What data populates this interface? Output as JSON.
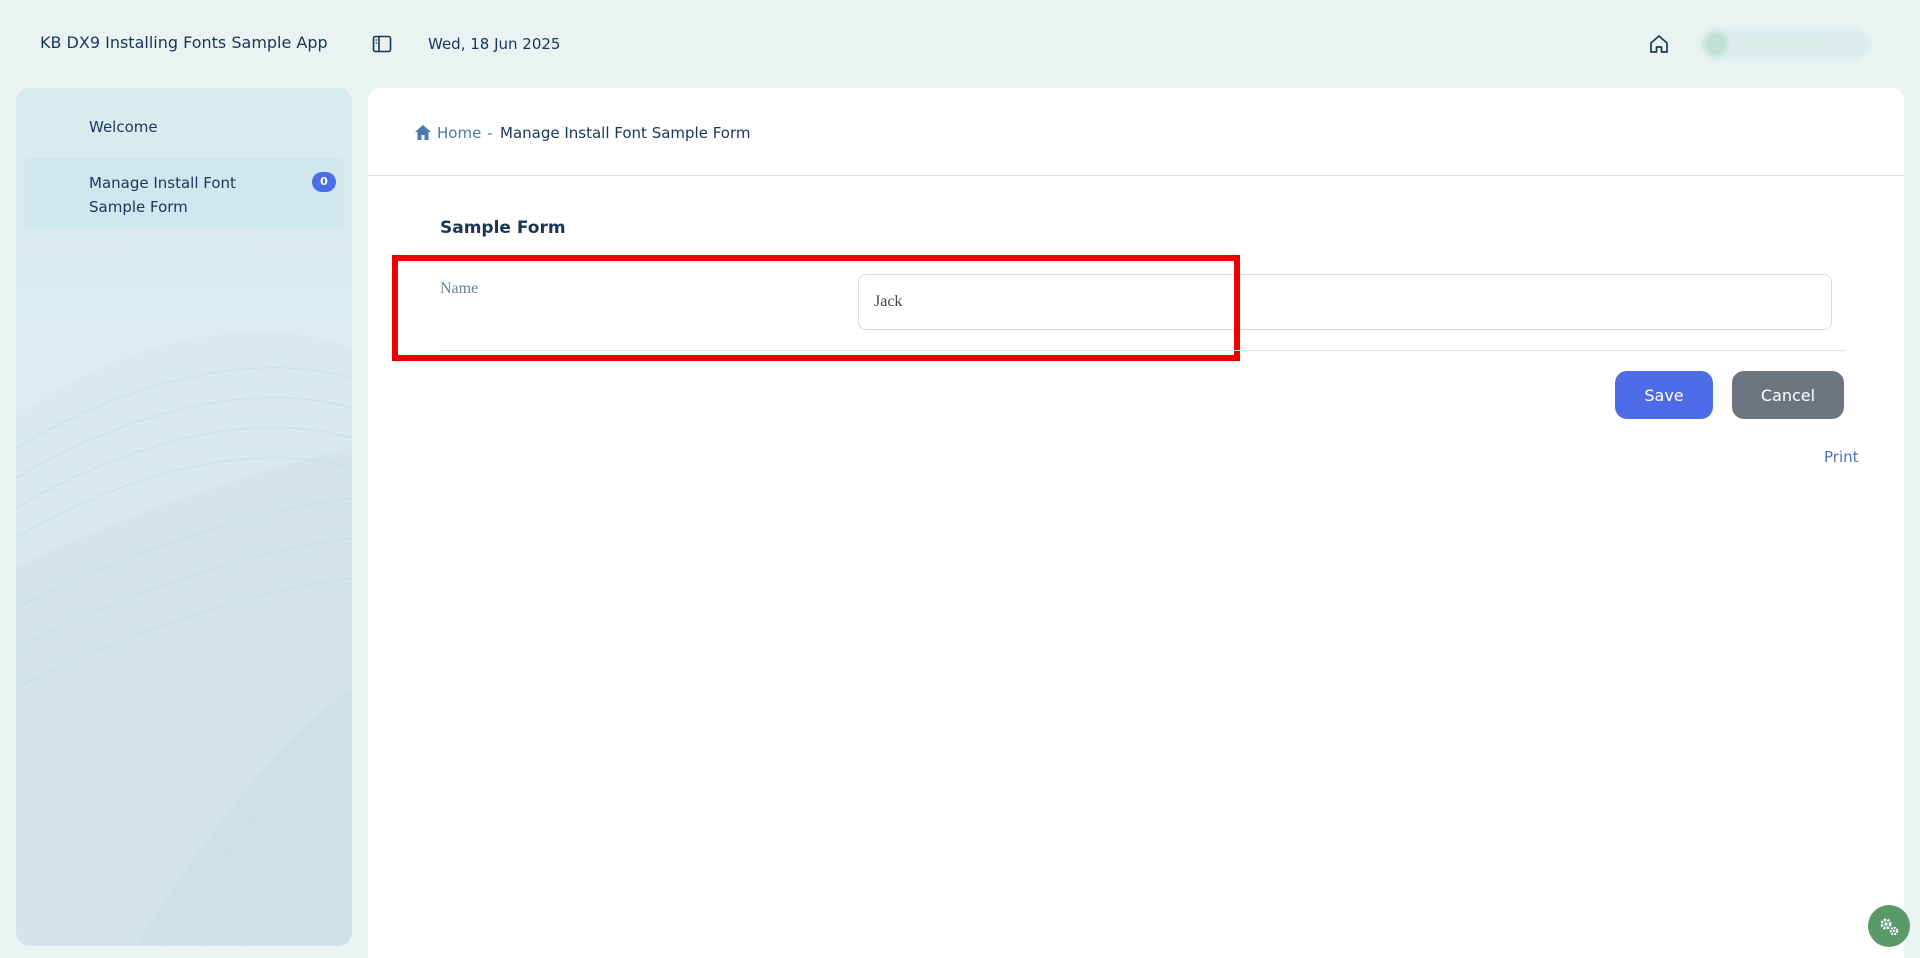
{
  "app": {
    "title": "KB DX9 Installing Fonts Sample App",
    "date": "Wed, 18 Jun 2025"
  },
  "sidebar": {
    "items": [
      {
        "label": "Welcome"
      },
      {
        "label": "Manage Install Font Sample Form",
        "badge": "0"
      }
    ]
  },
  "breadcrumb": {
    "home": "Home",
    "separator": "-",
    "current": "Manage Install Font Sample Form"
  },
  "form": {
    "title": "Sample Form",
    "name_label": "Name",
    "name_value": "Jack",
    "save_label": "Save",
    "cancel_label": "Cancel",
    "print_label": "Print"
  },
  "icons": {
    "sidebar_toggle": "sidebar-toggle-icon",
    "home": "home-icon",
    "breadcrumb_home": "home-icon",
    "settings": "gears-icon"
  },
  "colors": {
    "accent": "#4d6be6",
    "cancel": "#6c757d",
    "highlight": "#ee0000",
    "badge": "#4b6ee8",
    "fab": "#5a9a6a"
  }
}
